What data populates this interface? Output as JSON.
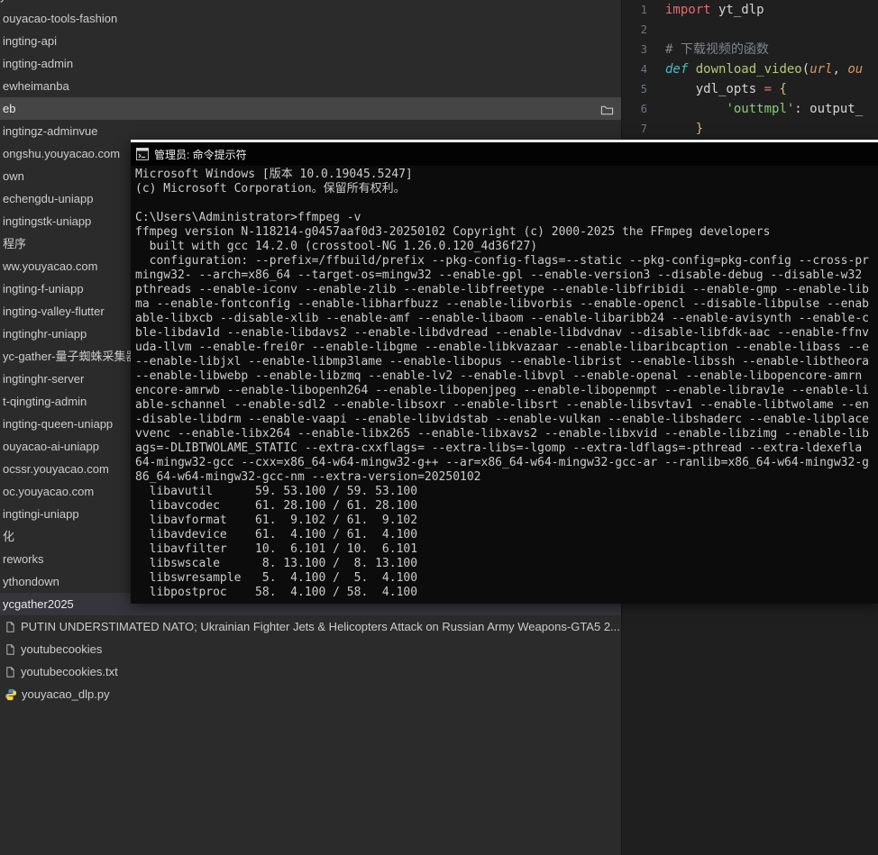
{
  "sidebar": {
    "partial_top_label": "y",
    "tree_items": [
      {
        "label": "ouyacao-tools-fashion"
      },
      {
        "label": "ingting-api"
      },
      {
        "label": "ingting-admin"
      },
      {
        "label": "ewheimanba"
      },
      {
        "label": "eb",
        "state": "active",
        "folder_icon": true
      },
      {
        "label": "ingtingz-adminvue"
      },
      {
        "label": "ongshu.youyacao.com"
      },
      {
        "label": "own"
      },
      {
        "label": "echengdu-uniapp"
      },
      {
        "label": "ingtingstk-uniapp"
      },
      {
        "label": "程序"
      },
      {
        "label": "ww.youyacao.com"
      },
      {
        "label": "ingting-f-uniapp"
      },
      {
        "label": "ingting-valley-flutter"
      },
      {
        "label": "ingtinghr-uniapp"
      },
      {
        "label": "yc-gather-量子蜘蛛采集器"
      },
      {
        "label": "ingtinghr-server"
      },
      {
        "label": "t-qingting-admin"
      },
      {
        "label": "ingting-queen-uniapp"
      },
      {
        "label": "ouyacao-ai-uniapp"
      },
      {
        "label": "ocssr.youyacao.com"
      },
      {
        "label": "oc.youyacao.com"
      },
      {
        "label": "ingtingi-uniapp"
      },
      {
        "label": "化"
      },
      {
        "label": "reworks"
      },
      {
        "label": "ythondown"
      },
      {
        "label": "ycgather2025",
        "state": "selected"
      }
    ],
    "file_items": [
      {
        "label": "PUTIN UNDERSTIMATED NATO; Ukrainian Fighter Jets & Helicopters  Attack on Russian Army Weapons-GTA5 2...",
        "icon": "file"
      },
      {
        "label": "youtubecookies",
        "icon": "file"
      },
      {
        "label": "youtubecookies.txt",
        "icon": "file"
      },
      {
        "label": "youyacao_dlp.py",
        "icon": "python"
      }
    ]
  },
  "editor": {
    "lines": [
      {
        "num": "1",
        "tokens": [
          {
            "c": "kw",
            "t": "import"
          },
          {
            "c": "plain",
            "t": " yt_dlp"
          }
        ]
      },
      {
        "num": "2",
        "tokens": []
      },
      {
        "num": "3",
        "tokens": [
          {
            "c": "comment",
            "t": "# 下载视频的函数"
          }
        ]
      },
      {
        "num": "4",
        "tokens": [
          {
            "c": "defkw",
            "t": "def"
          },
          {
            "c": "plain",
            "t": " "
          },
          {
            "c": "func",
            "t": "download_video"
          },
          {
            "c": "plain",
            "t": "("
          },
          {
            "c": "param",
            "t": "url"
          },
          {
            "c": "plain",
            "t": ", "
          },
          {
            "c": "param",
            "t": "ou"
          }
        ]
      },
      {
        "num": "5",
        "tokens": [
          {
            "c": "plain",
            "t": "    ydl_opts "
          },
          {
            "c": "kw",
            "t": "="
          },
          {
            "c": "plain",
            "t": " "
          },
          {
            "c": "bracket",
            "t": "{"
          }
        ]
      },
      {
        "num": "6",
        "tokens": [
          {
            "c": "plain",
            "t": "        "
          },
          {
            "c": "string",
            "t": "'outtmpl'"
          },
          {
            "c": "plain",
            "t": ": output_"
          }
        ]
      },
      {
        "num": "7",
        "tokens": [
          {
            "c": "plain",
            "t": "    "
          },
          {
            "c": "bracket",
            "t": "}"
          }
        ]
      }
    ]
  },
  "terminal": {
    "title": "管理员: 命令提示符",
    "lines": [
      "Microsoft Windows [版本 10.0.19045.5247]",
      "(c) Microsoft Corporation。保留所有权利。",
      "",
      "C:\\Users\\Administrator>ffmpeg -v",
      "ffmpeg version N-118214-g0457aaf0d3-20250102 Copyright (c) 2000-2025 the FFmpeg developers",
      "  built with gcc 14.2.0 (crosstool-NG 1.26.0.120_4d36f27)",
      "  configuration: --prefix=/ffbuild/prefix --pkg-config-flags=--static --pkg-config=pkg-config --cross-pr",
      "mingw32- --arch=x86_64 --target-os=mingw32 --enable-gpl --enable-version3 --disable-debug --disable-w32",
      "pthreads --enable-iconv --enable-zlib --enable-libfreetype --enable-libfribidi --enable-gmp --enable-lib",
      "ma --enable-fontconfig --enable-libharfbuzz --enable-libvorbis --enable-opencl --disable-libpulse --enab",
      "able-libxcb --disable-xlib --enable-amf --enable-libaom --enable-libaribb24 --enable-avisynth --enable-c",
      "ble-libdav1d --enable-libdavs2 --enable-libdvdread --enable-libdvdnav --disable-libfdk-aac --enable-ffnv",
      "uda-llvm --enable-frei0r --enable-libgme --enable-libkvazaar --enable-libaribcaption --enable-libass --e",
      "--enable-libjxl --enable-libmp3lame --enable-libopus --enable-librist --enable-libssh --enable-libtheora",
      "--enable-libwebp --enable-libzmq --enable-lv2 --enable-libvpl --enable-openal --enable-libopencore-amrn",
      "encore-amrwb --enable-libopenh264 --enable-libopenjpeg --enable-libopenmpt --enable-librav1e --enable-li",
      "able-schannel --enable-sdl2 --enable-libsoxr --enable-libsrt --enable-libsvtav1 --enable-libtwolame --en",
      "-disable-libdrm --enable-vaapi --enable-libvidstab --enable-vulkan --enable-libshaderc --enable-libplace",
      "vvenc --enable-libx264 --enable-libx265 --enable-libxavs2 --enable-libxvid --enable-libzimg --enable-lib",
      "ags=-DLIBTWOLAME_STATIC --extra-cxxflags= --extra-libs=-lgomp --extra-ldflags=-pthread --extra-ldexefla",
      "64-mingw32-gcc --cxx=x86_64-w64-mingw32-g++ --ar=x86_64-w64-mingw32-gcc-ar --ranlib=x86_64-w64-mingw32-g",
      "86_64-w64-mingw32-gcc-nm --extra-version=20250102",
      "  libavutil      59. 53.100 / 59. 53.100",
      "  libavcodec     61. 28.100 / 61. 28.100",
      "  libavformat    61.  9.102 / 61.  9.102",
      "  libavdevice    61.  4.100 / 61.  4.100",
      "  libavfilter    10.  6.101 / 10.  6.101",
      "  libswscale      8. 13.100 /  8. 13.100",
      "  libswresample   5.  4.100 /  5.  4.100",
      "  libpostproc    58.  4.100 / 58.  4.100"
    ]
  },
  "colors": {
    "terminal_bg": "#0c0c0c",
    "terminal_text": "#cccccc",
    "sidebar_bg": "#2b2b2b",
    "editor_bg": "#1f1f1f",
    "keyword": "#e06c75",
    "string": "#89ca78",
    "param": "#d19a66"
  }
}
